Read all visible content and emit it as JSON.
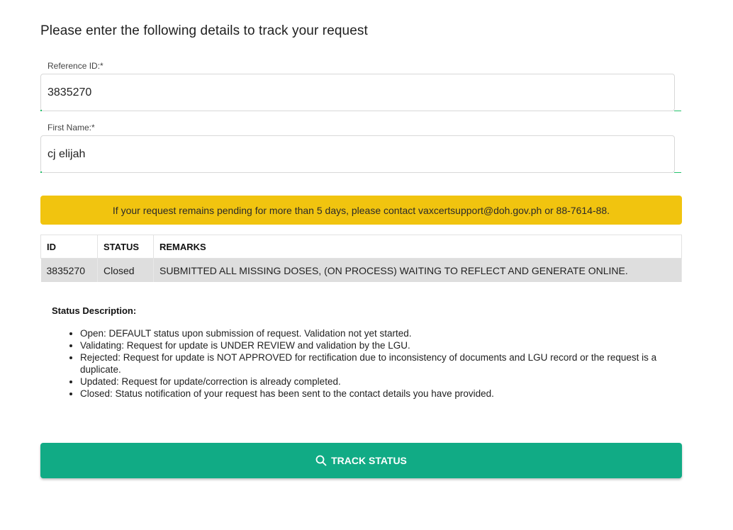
{
  "form": {
    "title": "Please enter the following details to track your request",
    "reference_label": "Reference ID:*",
    "reference_value": "3835270",
    "firstname_label": "First Name:*",
    "firstname_value": "cj elijah"
  },
  "notice": {
    "text": "If your request remains pending for more than 5 days, please contact vaxcertsupport@doh.gov.ph or 88-7614-88.",
    "color": "#f1c40f"
  },
  "table": {
    "headers": [
      "ID",
      "STATUS",
      "REMARKS"
    ],
    "rows": [
      [
        "3835270",
        "Closed",
        "SUBMITTED ALL MISSING DOSES, (ON PROCESS) WAITING TO REFLECT AND GENERATE ONLINE."
      ]
    ]
  },
  "status_description": {
    "title": "Status Description:",
    "items": [
      "Open: DEFAULT status upon submission of request. Validation not yet started.",
      "Validating: Request for update is UNDER REVIEW and validation by the LGU.",
      "Rejected: Request for update is NOT APPROVED for rectification due to inconsistency of documents and LGU record or the request is a duplicate.",
      "Updated: Request for update/correction is already completed.",
      "Closed: Status notification of your request has been sent to the contact details you have provided."
    ]
  },
  "button": {
    "label": "TRACK STATUS",
    "icon": "search-icon",
    "color": "#11ab85"
  }
}
